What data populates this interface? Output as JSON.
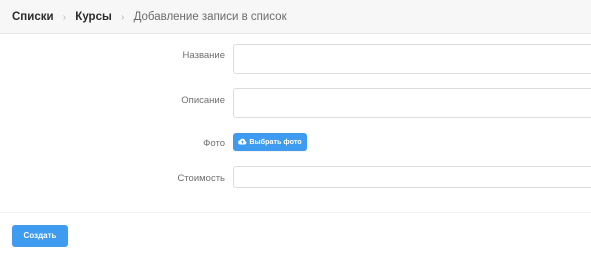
{
  "breadcrumb": {
    "items": [
      "Списки",
      "Курсы"
    ],
    "current": "Добавление записи в список"
  },
  "form": {
    "name_label": "Название",
    "description_label": "Описание",
    "photo_label": "Фото",
    "photo_button_label": "Выбрать фото",
    "price_label": "Стоимость",
    "name_value": "",
    "description_value": "",
    "price_value": ""
  },
  "actions": {
    "create_label": "Создать"
  },
  "colors": {
    "primary": "#3f9bf0",
    "header_bg": "#f7f7f7"
  },
  "icons": {
    "upload": "cloud-upload-icon",
    "breadcrumb_separator": "chevron-right-icon"
  }
}
